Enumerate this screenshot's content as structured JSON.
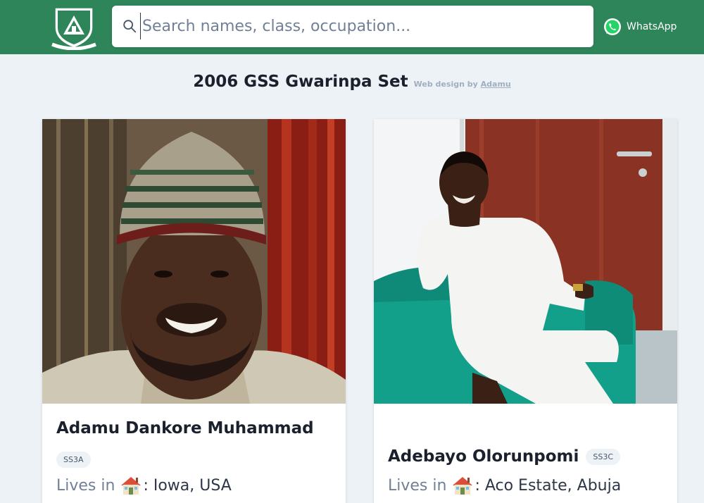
{
  "header": {
    "search_placeholder": "Search names, class, occupation...",
    "whatsapp_label": "WhatsApp",
    "brand_color": "#2f855a"
  },
  "page": {
    "title": "2006 GSS Gwarinpa Set",
    "credit_prefix": "Web design by",
    "credit_link": "Adamu"
  },
  "cards": [
    {
      "name": "Adamu Dankore Muhammad",
      "class": "SS3A",
      "lives_label": "Lives in",
      "location": ": Iowa, USA"
    },
    {
      "name": "Adebayo Olorunpomi",
      "class": "SS3C",
      "lives_label": "Lives in",
      "location": ": Aco Estate, Abuja"
    }
  ]
}
